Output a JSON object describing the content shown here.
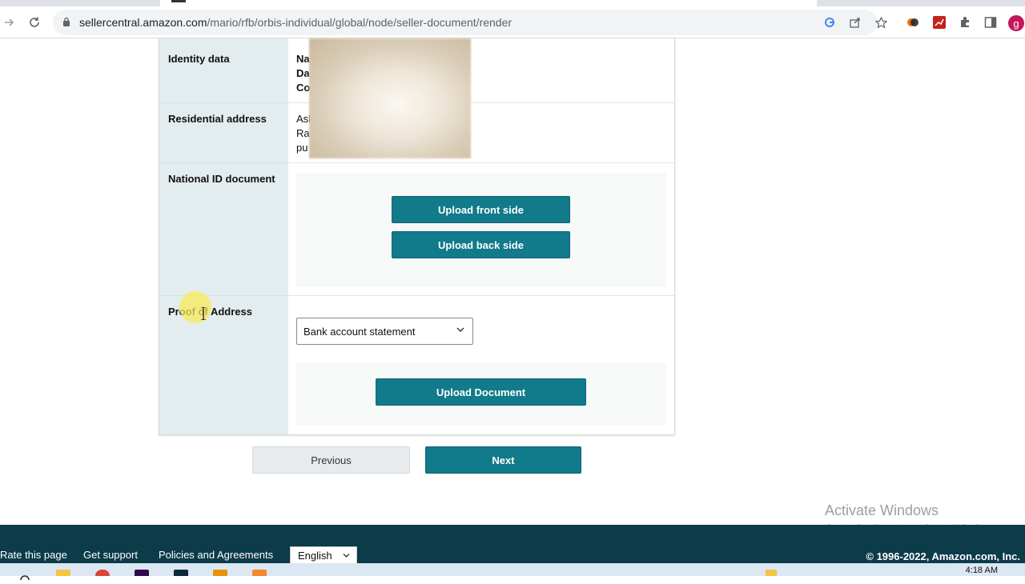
{
  "browser": {
    "url_host": "sellercentral.amazon.com",
    "url_path": "/mario/rfb/orbis-individual/global/node/seller-document/render",
    "profile_initial": "g",
    "icons": [
      "back-icon",
      "forward-icon",
      "reload-icon",
      "lock-icon",
      "google-icon",
      "share-icon",
      "star-icon",
      "extension-icon",
      "puzzle-icon",
      "sidepanel-icon"
    ]
  },
  "form": {
    "rows": [
      {
        "label": "Identity data",
        "values": [
          "Na",
          "Da",
          "Co"
        ]
      },
      {
        "label": "Residential address",
        "values": [
          "Asl",
          "Ra",
          "pu"
        ]
      },
      {
        "label": "National ID document",
        "buttons": [
          "Upload front side",
          "Upload back side"
        ]
      },
      {
        "label": "Proof of Address",
        "select_value": "Bank account statement",
        "button": "Upload Document"
      }
    ]
  },
  "nav": {
    "previous_label": "Previous",
    "next_label": "Next"
  },
  "watermark": {
    "title": "Activate Windows",
    "subtitle": "Go to Settings to activate Windows."
  },
  "footer": {
    "links": [
      "Rate this page",
      "Get support",
      "Policies and Agreements"
    ],
    "language": "English",
    "copyright": "© 1996-2022, Amazon.com, Inc."
  },
  "taskbar": {
    "time": "4:18 AM"
  },
  "colors": {
    "teal_button": "#117a8b",
    "footer_bg": "#0c3b4a",
    "label_col_bg": "#e3ecee"
  }
}
